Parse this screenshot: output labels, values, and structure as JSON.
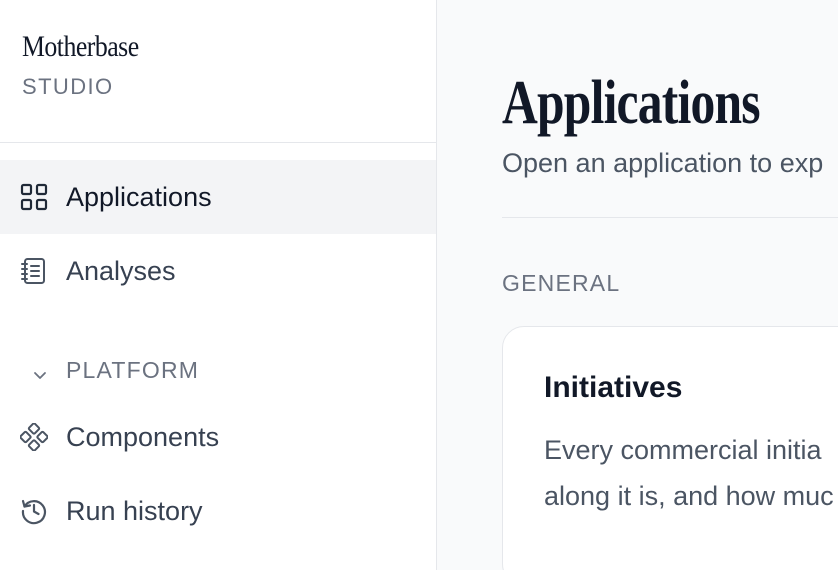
{
  "brand": {
    "name": "Motherbase",
    "subtitle": "STUDIO"
  },
  "sidebar": {
    "items": [
      {
        "label": "Applications",
        "icon": "grid-icon",
        "active": true
      },
      {
        "label": "Analyses",
        "icon": "notebook-icon",
        "active": false
      }
    ],
    "sections": [
      {
        "label": "PLATFORM",
        "expanded": true,
        "items": [
          {
            "label": "Components",
            "icon": "components-icon"
          },
          {
            "label": "Run history",
            "icon": "history-icon"
          }
        ]
      }
    ]
  },
  "main": {
    "title": "Applications",
    "subtitle": "Open an application to exp",
    "group_label": "GENERAL",
    "cards": [
      {
        "title": "Initiatives",
        "description_line1": "Every commercial initia",
        "description_line2": "along it is, and how muc"
      }
    ]
  },
  "colors": {
    "sidebar_bg": "#ffffff",
    "main_bg": "#f9fafb",
    "active_bg": "#f3f4f6",
    "border": "#e5e7eb",
    "text_primary": "#111827",
    "text_muted": "#6b7280"
  }
}
